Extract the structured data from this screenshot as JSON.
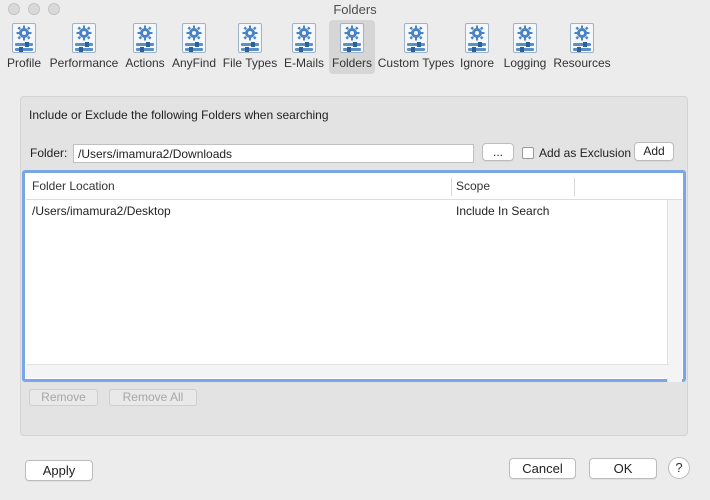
{
  "window": {
    "title": "Folders"
  },
  "toolbar": {
    "items": [
      {
        "label": "Profile",
        "icon": "settings-doc-icon"
      },
      {
        "label": "Performance",
        "icon": "settings-doc-icon"
      },
      {
        "label": "Actions",
        "icon": "settings-doc-icon"
      },
      {
        "label": "AnyFind",
        "icon": "settings-doc-icon"
      },
      {
        "label": "File Types",
        "icon": "settings-doc-icon"
      },
      {
        "label": "E-Mails",
        "icon": "settings-doc-icon"
      },
      {
        "label": "Folders",
        "icon": "settings-doc-icon"
      },
      {
        "label": "Custom Types",
        "icon": "settings-doc-icon"
      },
      {
        "label": "Ignore",
        "icon": "settings-doc-icon"
      },
      {
        "label": "Logging",
        "icon": "settings-doc-icon"
      },
      {
        "label": "Resources",
        "icon": "settings-doc-icon"
      }
    ],
    "selected": "Folders"
  },
  "panel": {
    "heading": "Include or Exclude the following Folders when searching",
    "folder_label": "Folder:",
    "folder_value": "/Users/imamura2/Downloads",
    "browse_label": "...",
    "exclusion_label": "Add as Exclusion",
    "exclusion_checked": false,
    "add_label": "Add",
    "table": {
      "columns": [
        "Folder Location",
        "Scope"
      ],
      "rows": [
        {
          "location": "/Users/imamura2/Desktop",
          "scope": "Include In Search"
        }
      ]
    },
    "remove_label": "Remove",
    "remove_all_label": "Remove All"
  },
  "footer": {
    "apply_label": "Apply",
    "cancel_label": "Cancel",
    "ok_label": "OK",
    "help_label": "?"
  },
  "colors": {
    "focus_ring": "#7aa5e6",
    "icon_accent": "#5a8fc8"
  }
}
